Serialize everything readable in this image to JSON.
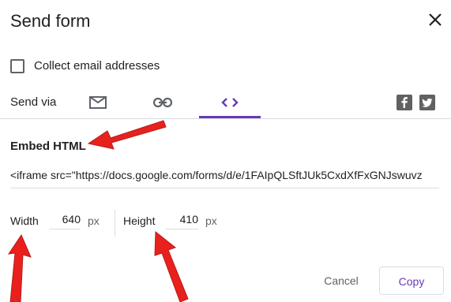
{
  "dialog": {
    "title": "Send form",
    "collect_email_label": "Collect email addresses",
    "collect_email_checked": false,
    "send_via_label": "Send via",
    "tabs": [
      {
        "icon": "email-icon",
        "selected": false
      },
      {
        "icon": "link-icon",
        "selected": false
      },
      {
        "icon": "embed-code-icon",
        "selected": true
      }
    ],
    "share": [
      "facebook-icon",
      "twitter-icon"
    ]
  },
  "embed": {
    "heading": "Embed HTML",
    "code": "<iframe src=\"https://docs.google.com/forms/d/e/1FAIpQLSftJUk5CxdXfFxGNJswuvz",
    "width_label": "Width",
    "width_value": "640",
    "height_label": "Height",
    "height_value": "410",
    "unit": "px"
  },
  "actions": {
    "cancel_label": "Cancel",
    "copy_label": "Copy"
  },
  "colors": {
    "accent": "#673ab7",
    "annotation_arrow": "#e8211c",
    "text": "#202124",
    "muted": "#5f6368"
  }
}
